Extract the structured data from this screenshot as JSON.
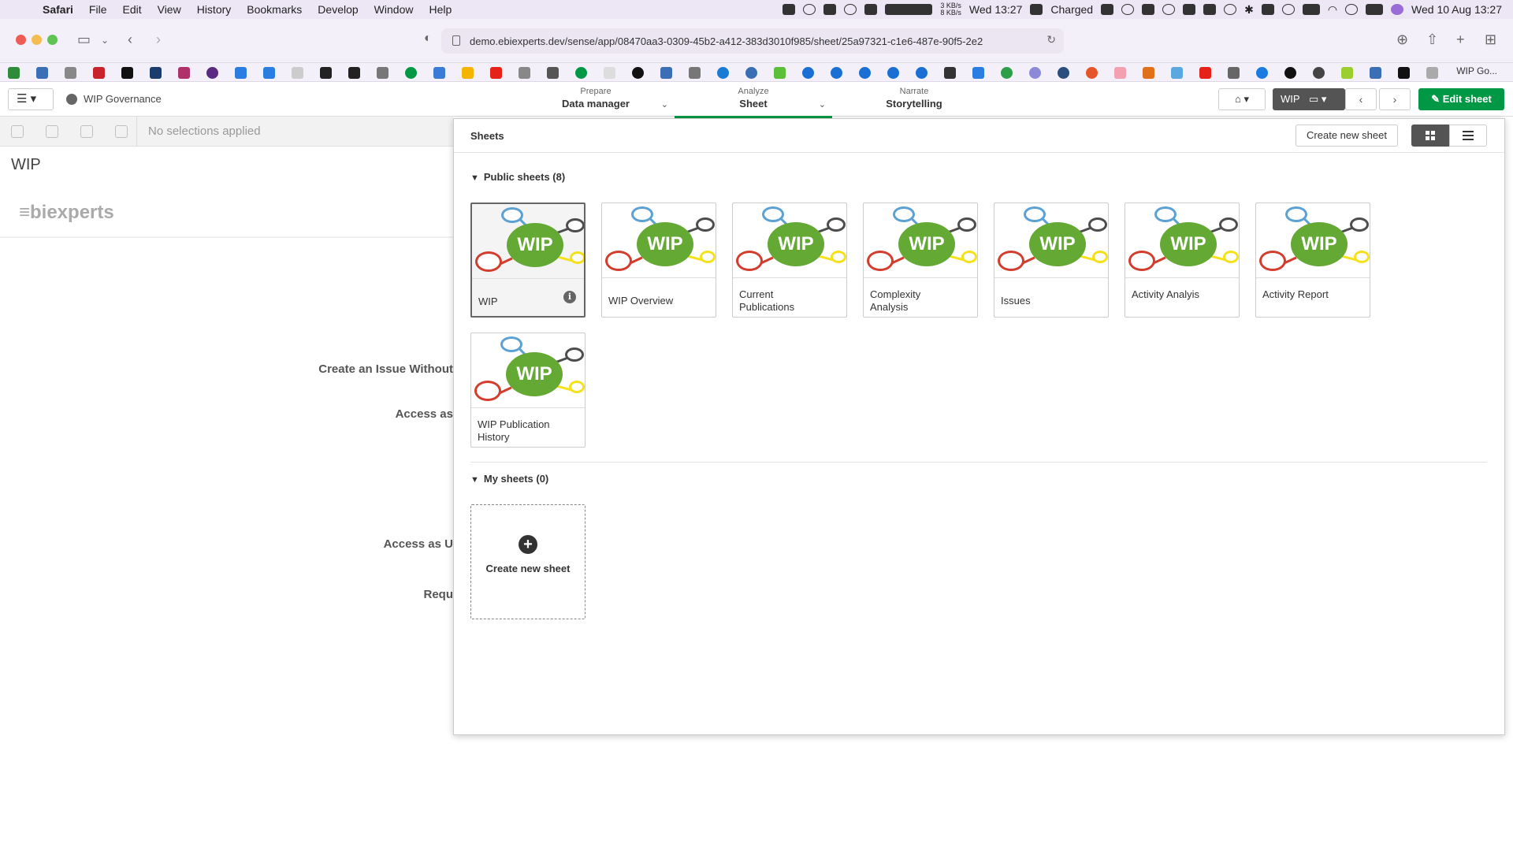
{
  "menubar": {
    "app": "Safari",
    "items": [
      "File",
      "Edit",
      "View",
      "History",
      "Bookmarks",
      "Develop",
      "Window",
      "Help"
    ],
    "net_up": "3 KB/s",
    "net_down": "8 KB/s",
    "clock1": "Wed 13:27",
    "battery": "Charged",
    "clock2": "Wed 10 Aug  13:27"
  },
  "browser": {
    "url": "demo.ebiexperts.dev/sense/app/08470aa3-0309-45b2-a412-383d3010f985/sheet/25a97321-c1e6-487e-90f5-2e2",
    "active_tab": "WIP Go..."
  },
  "qlik": {
    "app_title": "WIP Governance",
    "modes": [
      {
        "sub": "Prepare",
        "main": "Data manager"
      },
      {
        "sub": "Analyze",
        "main": "Sheet"
      },
      {
        "sub": "Narrate",
        "main": "Storytelling"
      }
    ],
    "sheet_button": "WIP",
    "edit_sheet": "Edit sheet",
    "no_selections": "No selections applied"
  },
  "background": {
    "sheet_title": "WIP",
    "logo": "≡biexperts",
    "lines": [
      "Create an Issue Without",
      "Access as",
      "Access as U",
      "Requ"
    ]
  },
  "panel": {
    "title": "Sheets",
    "create_button": "Create new sheet",
    "public_section": "Public sheets (8)",
    "my_section": "My sheets (0)",
    "thumb_text": "WIP",
    "sheets": [
      {
        "title": "WIP"
      },
      {
        "title": "WIP Overview"
      },
      {
        "title": "Current Publications"
      },
      {
        "title": "Complexity Analysis"
      },
      {
        "title": "Issues"
      },
      {
        "title": "Activity Analyis"
      },
      {
        "title": "Activity Report"
      },
      {
        "title": "WIP Publication History"
      }
    ],
    "create_card_label": "Create new sheet"
  },
  "colors": {
    "accent": "#009845",
    "wip_green": "#63a934",
    "circle_blue": "#5ba1d4",
    "circle_red": "#d23d2e",
    "circle_yellow": "#f4e11b",
    "circle_gray": "#4d4d4d"
  }
}
